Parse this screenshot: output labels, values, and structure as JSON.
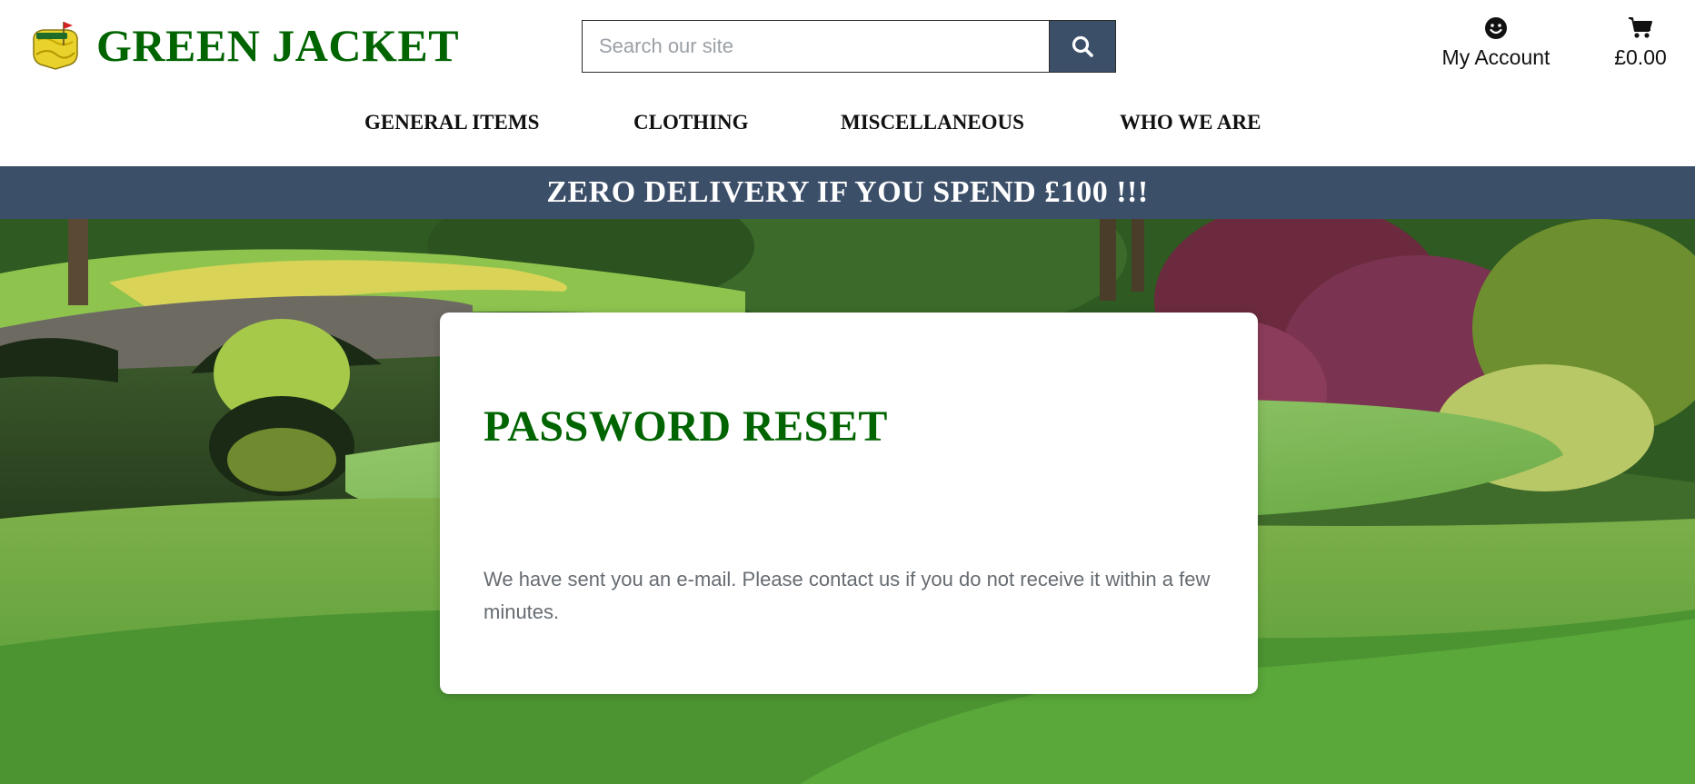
{
  "brand": {
    "name": "GREEN JACKET",
    "logo_icon": "masters-logo-icon"
  },
  "search": {
    "placeholder": "Search our site",
    "value": "",
    "icon": "search-icon"
  },
  "account": {
    "label": "My Account",
    "icon": "smiley-icon"
  },
  "cart": {
    "total": "£0.00",
    "icon": "cart-icon"
  },
  "nav": {
    "items": [
      {
        "label": "GENERAL ITEMS"
      },
      {
        "label": "CLOTHING"
      },
      {
        "label": "MISCELLANEOUS"
      },
      {
        "label": "WHO WE ARE"
      }
    ]
  },
  "banner": {
    "text": "ZERO DELIVERY IF YOU SPEND £100 !!!"
  },
  "page": {
    "title": "PASSWORD RESET",
    "message": "We have sent you an e-mail. Please contact us if you do not receive it within a few minutes."
  },
  "colors": {
    "brand_green": "#006400",
    "banner_blue": "#3c4f69",
    "card_bg": "#ffffff",
    "message_gray": "#666c72"
  }
}
